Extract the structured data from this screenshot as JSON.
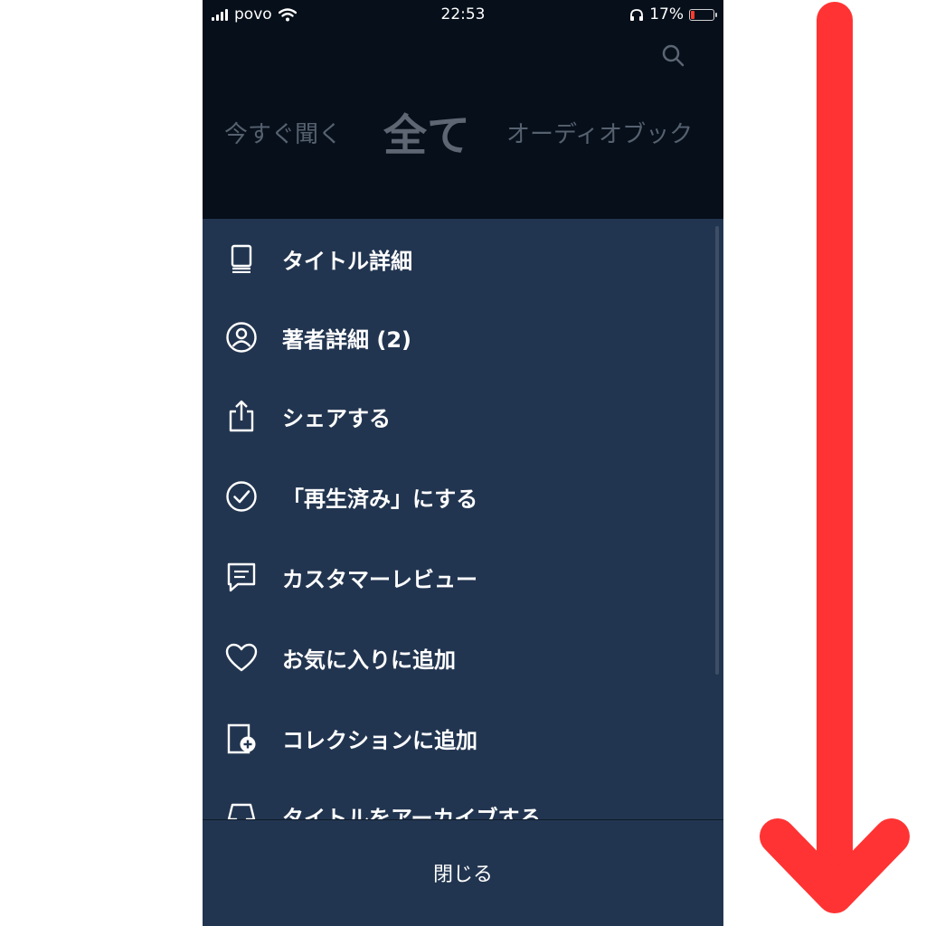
{
  "status_bar": {
    "carrier": "povo",
    "time": "22:53",
    "battery_percent": "17%",
    "battery_level": 0.17
  },
  "header": {
    "search_icon": "search-icon",
    "tabs": [
      {
        "label": "今すぐ聞く"
      },
      {
        "label": "全て",
        "selected": true
      },
      {
        "label": "オーディオブック"
      }
    ]
  },
  "menu": {
    "items": [
      {
        "label": "タイトル詳細",
        "icon": "book-icon"
      },
      {
        "label": "著者詳細 (2)",
        "icon": "person-icon"
      },
      {
        "label": "シェアする",
        "icon": "share-icon"
      },
      {
        "label": "「再生済み」にする",
        "icon": "check-circle-icon"
      },
      {
        "label": "カスタマーレビュー",
        "icon": "comment-icon"
      },
      {
        "label": "お気に入りに追加",
        "icon": "heart-icon"
      },
      {
        "label": "コレクションに追加",
        "icon": "add-collection-icon"
      },
      {
        "label": "タイトルをアーカイブする",
        "icon": "archive-icon"
      }
    ],
    "close_label": "閉じる"
  },
  "colors": {
    "background": "#060f1a",
    "sheet": "#223550",
    "arrow": "#ff3333"
  }
}
